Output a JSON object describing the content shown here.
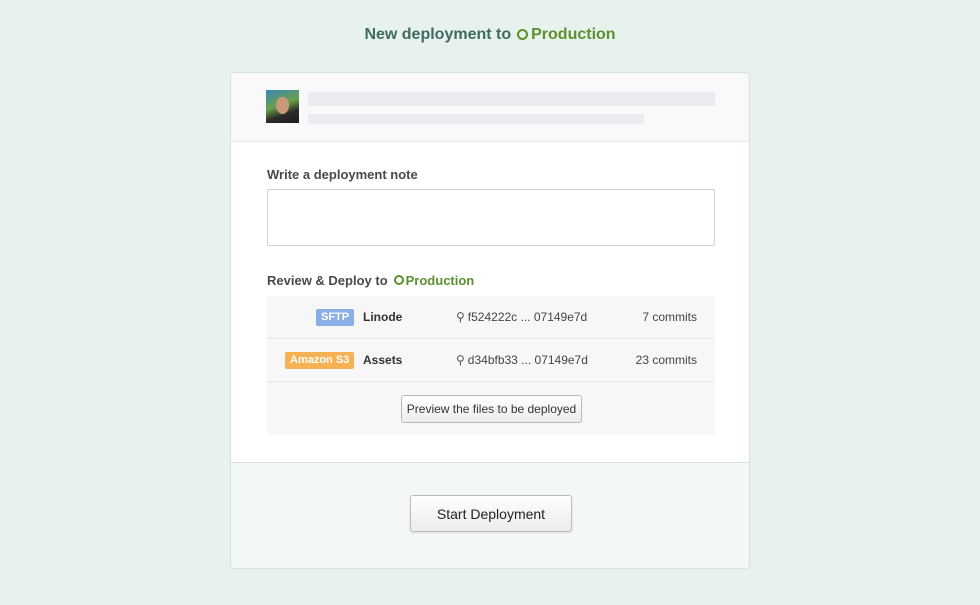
{
  "header": {
    "title": "New deployment to",
    "environment": "Production"
  },
  "colors": {
    "environment": "#5c8f2e",
    "title": "#3f6a62",
    "sftp_badge": "#8aaee6",
    "s3_badge": "#f6b252"
  },
  "note": {
    "label": "Write a deployment note",
    "value": "",
    "placeholder": ""
  },
  "review": {
    "label": "Review & Deploy to",
    "environment": "Production"
  },
  "servers": [
    {
      "badge": "SFTP",
      "name": "Linode",
      "icon": "branch-compare-icon",
      "range": "f524222c ... 07149e7d",
      "commits": "7 commits"
    },
    {
      "badge": "Amazon S3",
      "name": "Assets",
      "icon": "branch-compare-icon",
      "range": "d34bfb33 ... 07149e7d",
      "commits": "23 commits"
    }
  ],
  "preview_button": "Preview the files to be deployed",
  "start_button": "Start Deployment"
}
